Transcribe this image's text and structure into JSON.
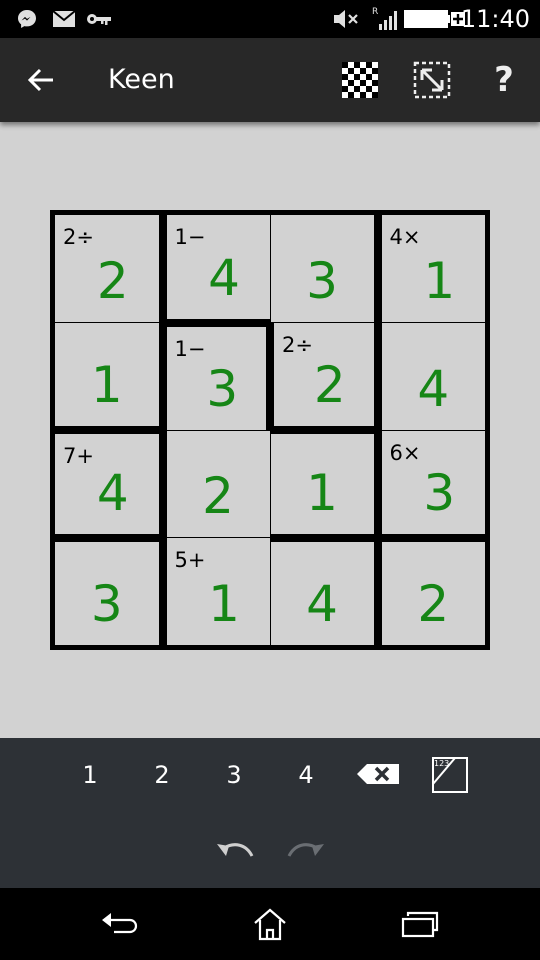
{
  "status_bar": {
    "time": "11:40",
    "signal_label": "R",
    "icons": [
      "messenger-icon",
      "mail-icon",
      "key-icon",
      "mute-icon",
      "signal-icon",
      "battery-icon"
    ]
  },
  "action_bar": {
    "title": "Keen",
    "help_label": "?",
    "icons": [
      "back-arrow-icon",
      "checkerboard-icon",
      "resize-icon"
    ]
  },
  "puzzle": {
    "size": 4,
    "rows": [
      [
        {
          "value": "2",
          "clue": "2÷"
        },
        {
          "value": "4",
          "clue": "1−"
        },
        {
          "value": "3",
          "clue": ""
        },
        {
          "value": "1",
          "clue": "4×"
        }
      ],
      [
        {
          "value": "1",
          "clue": ""
        },
        {
          "value": "3",
          "clue": "1−"
        },
        {
          "value": "2",
          "clue": "2÷"
        },
        {
          "value": "4",
          "clue": ""
        }
      ],
      [
        {
          "value": "4",
          "clue": "7+"
        },
        {
          "value": "2",
          "clue": ""
        },
        {
          "value": "1",
          "clue": ""
        },
        {
          "value": "3",
          "clue": "6×"
        }
      ],
      [
        {
          "value": "3",
          "clue": ""
        },
        {
          "value": "1",
          "clue": "5+"
        },
        {
          "value": "4",
          "clue": ""
        },
        {
          "value": "2",
          "clue": ""
        }
      ]
    ],
    "digit_color": "#168616"
  },
  "keypad": {
    "keys": [
      "1",
      "2",
      "3",
      "4"
    ],
    "marks_label": "123",
    "icons": [
      "backspace-icon",
      "marks-icon",
      "undo-icon",
      "redo-icon"
    ]
  },
  "nav_bar": {
    "icons": [
      "back-nav-icon",
      "home-icon",
      "recents-icon"
    ]
  }
}
